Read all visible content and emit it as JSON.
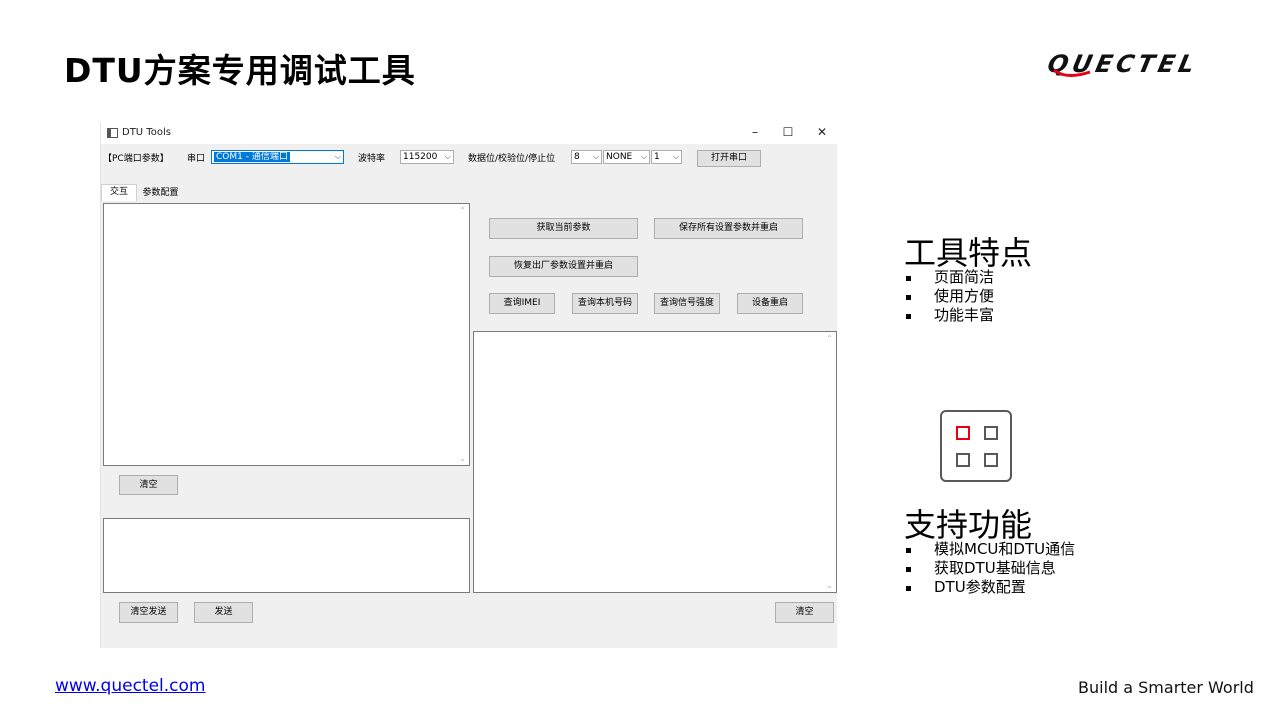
{
  "slide": {
    "title": "DTU方案专用调试工具",
    "logo": "QUECTEL",
    "footer_link": "www.quectel.com",
    "slogan": "Build a Smarter World"
  },
  "app": {
    "window_title": "DTU Tools",
    "window_controls": {
      "minimize": "–",
      "maximize": "☐",
      "close": "✕"
    },
    "toolbar": {
      "pc_port_params_label": "【PC端口参数】",
      "port_label": "串口",
      "port_value": "COM1 - 通信端口",
      "baud_label": "波特率",
      "baud_value": "115200",
      "frame_label": "数据位/校验位/停止位",
      "databits_value": "8",
      "parity_value": "NONE",
      "stopbits_value": "1",
      "open_port_button": "打开串口"
    },
    "tabs": [
      {
        "label": "交互"
      },
      {
        "label": "参数配置"
      }
    ],
    "buttons": {
      "get_params": "获取当前参数",
      "save_restart": "保存所有设置参数并重启",
      "factory_reset": "恢复出厂参数设置并重启",
      "query_imei": "查询IMEI",
      "query_number": "查询本机号码",
      "query_signal": "查询信号强度",
      "device_restart": "设备重启",
      "clear_left": "清空",
      "clear_send": "清空发送",
      "send": "发送",
      "clear_right": "清空"
    }
  },
  "features": {
    "title": "工具特点",
    "items": [
      "页面简洁",
      "使用方便",
      "功能丰富"
    ]
  },
  "support": {
    "title": "支持功能",
    "items": [
      "模拟MCU和DTU通信",
      "获取DTU基础信息",
      "DTU参数配置"
    ]
  }
}
